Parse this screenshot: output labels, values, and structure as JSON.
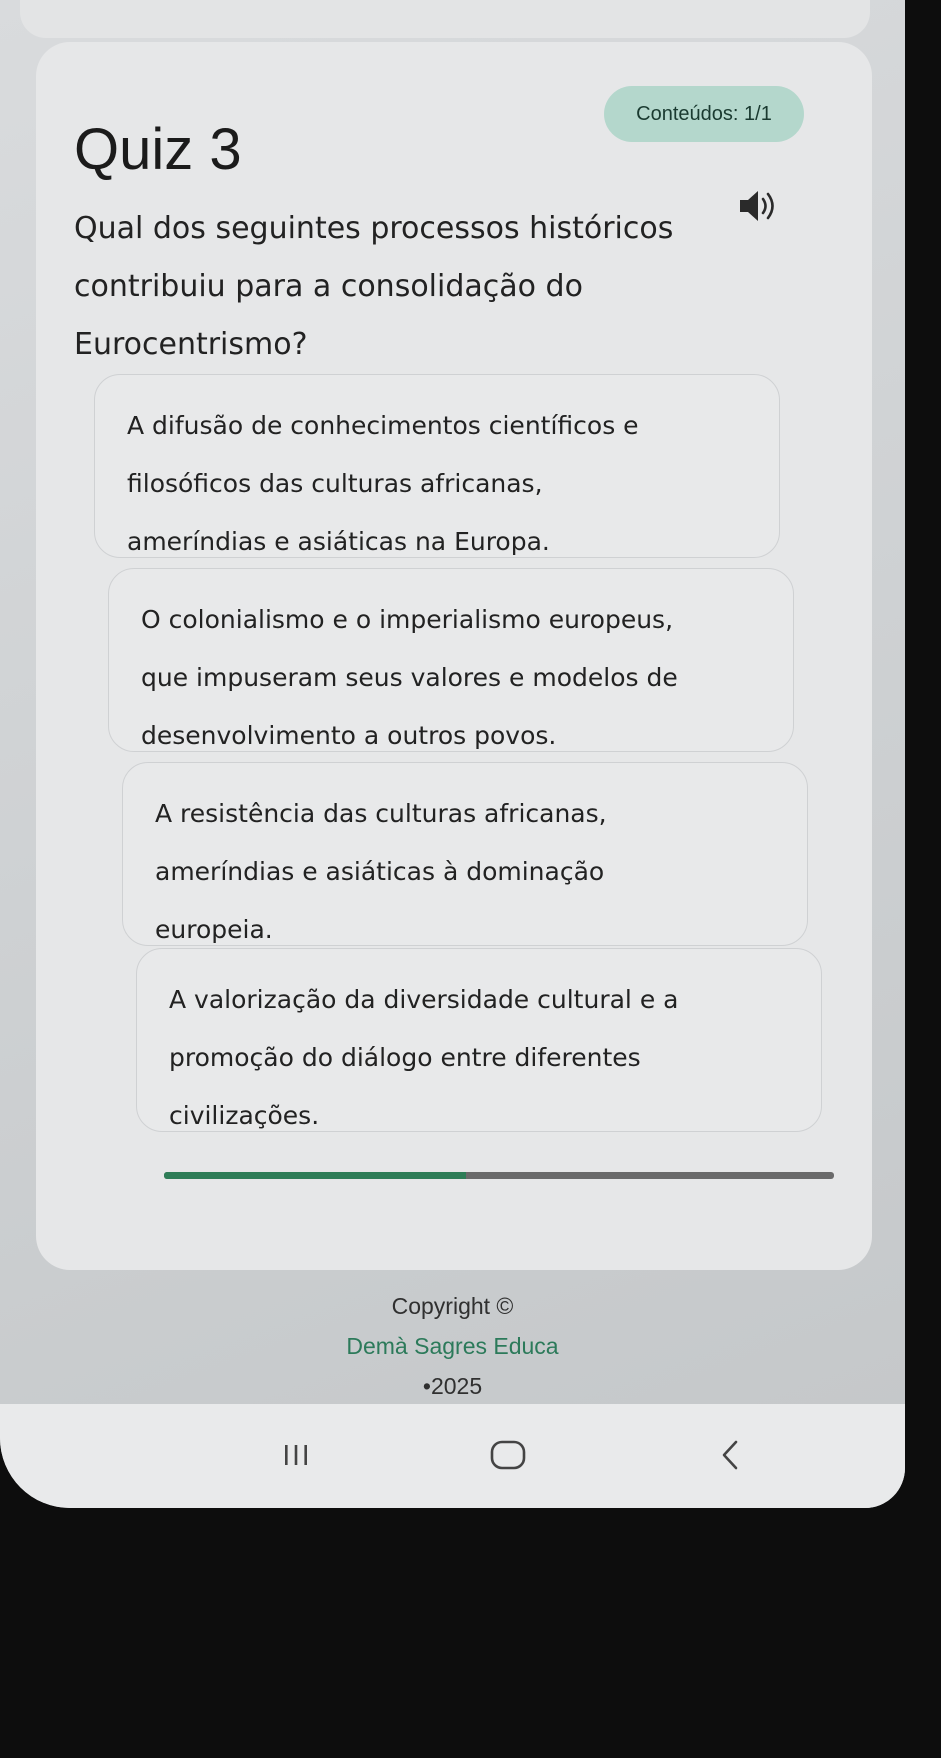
{
  "quiz": {
    "title": "Quiz 3",
    "contents_label": "Conteúdos: 1/1",
    "question": "Qual dos seguintes processos históricos contribuiu para a consolidação do Eurocentrismo?",
    "options": [
      {
        "lines": [
          "A difusão de conhecimentos científicos e",
          "filosóficos das culturas africanas,",
          "ameríndias e asiáticas na Europa."
        ]
      },
      {
        "lines": [
          "O colonialismo e o imperialismo europeus,",
          "que impuseram seus valores e modelos de",
          "desenvolvimento a outros povos."
        ]
      },
      {
        "lines": [
          "A resistência das culturas africanas,",
          "ameríndias e asiáticas à dominação",
          "europeia."
        ]
      },
      {
        "lines": [
          "A valorização da diversidade cultural e a",
          "promoção do diálogo entre diferentes",
          "civilizações."
        ]
      }
    ],
    "progress_fraction": 0.45
  },
  "footer": {
    "copyright": "Copyright ©",
    "brand": "Demà Sagres Educa",
    "year": "•2025"
  },
  "icons": {
    "audio": "speaker-icon",
    "recents": "recent-apps-icon",
    "home": "home-icon",
    "back": "back-icon"
  },
  "colors": {
    "accent": "#2e7d57",
    "badge_bg": "#b4d7cc",
    "brand_text": "#2c7a5a"
  }
}
